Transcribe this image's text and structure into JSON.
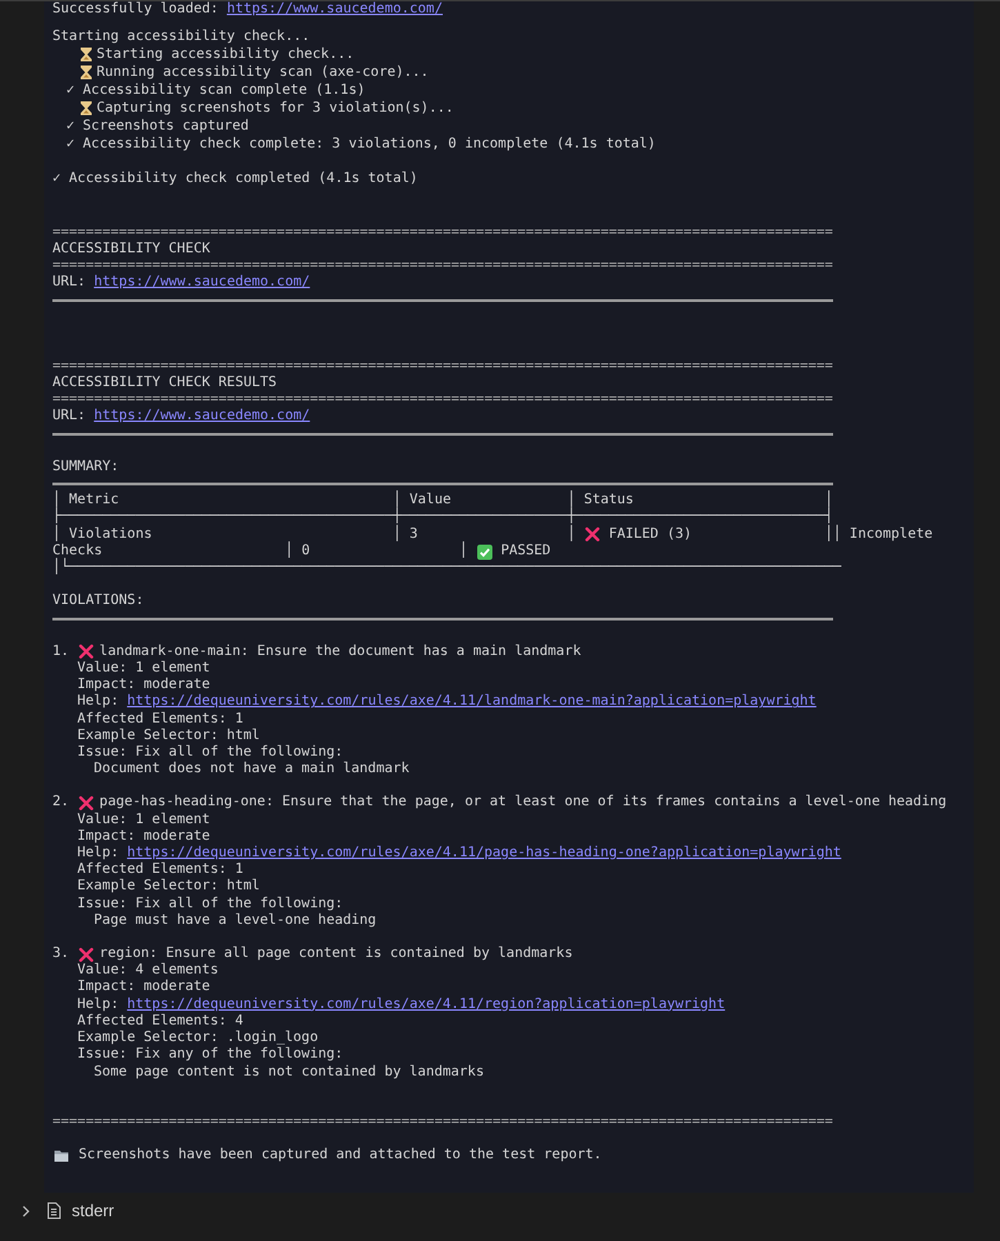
{
  "log": {
    "loaded": {
      "label": "Successfully loaded:",
      "url": "https://www.saucedemo.com/"
    },
    "progress": {
      "title": "Starting accessibility check...",
      "steps": [
        {
          "kind": "pending",
          "text": "Starting accessibility check..."
        },
        {
          "kind": "pending",
          "text": "Running accessibility scan (axe-core)..."
        },
        {
          "kind": "done",
          "mark": "✓",
          "text": "Accessibility scan complete (1.1s)"
        },
        {
          "kind": "pending",
          "text": "Capturing screenshots for 3 violation(s)..."
        },
        {
          "kind": "done",
          "mark": "✓",
          "text": "Screenshots captured"
        },
        {
          "kind": "done",
          "mark": "✓",
          "text": "Accessibility check complete: 3 violations, 0 incomplete (4.1s total)"
        }
      ]
    },
    "completed": {
      "mark": "✓",
      "text": "Accessibility check completed (4.1s total)"
    },
    "banners": [
      {
        "rule": "==============================================================================================",
        "title": "ACCESSIBILITY CHECK",
        "url_label": "URL:",
        "url": "https://www.saucedemo.com/"
      },
      {
        "rule": "==============================================================================================",
        "title": "ACCESSIBILITY CHECK RESULTS",
        "url_label": "URL:",
        "url": "https://www.saucedemo.com/"
      }
    ],
    "summary": {
      "title": "SUMMARY:",
      "lines": [
        [
          {
            "kind": "text",
            "text": "│ Metric                                 │ Value              │ Status                       │"
          }
        ],
        [
          {
            "kind": "text",
            "text": "├────────────────────────────────────────┼────────────────────┼──────────────────────────────┤"
          }
        ],
        [
          {
            "kind": "text",
            "text": "│ Violations                             │ 3                  │ "
          },
          {
            "kind": "fail"
          },
          {
            "kind": "text",
            "text": " FAILED (3)                ││ Incomplete"
          }
        ],
        [
          {
            "kind": "text",
            "text": "Checks                      │ 0                  │ "
          },
          {
            "kind": "pass"
          },
          {
            "kind": "text",
            "text": " PASSED"
          }
        ],
        [
          {
            "kind": "text",
            "text": "│└─────────────────────────────────────────────────────────────────────────────────────────────"
          }
        ]
      ]
    },
    "violations": {
      "title": "VIOLATIONS:",
      "items": [
        {
          "number": "1.",
          "kind": "fail",
          "text": "landmark-one-main: Ensure the document has a main landmark",
          "value": "Value: 1 element",
          "impact": "Impact: moderate",
          "help_label": "Help:",
          "help_url": "https://dequeuniversity.com/rules/axe/4.11/landmark-one-main?application=playwright",
          "affected": "Affected Elements: 1",
          "selector": "Example Selector: html",
          "issue": "Issue: Fix all of the following:",
          "message": "Document does not have a main landmark"
        },
        {
          "number": "2.",
          "kind": "fail",
          "text": "page-has-heading-one: Ensure that the page, or at least one of its frames contains a level-one heading",
          "value": "Value: 1 element",
          "impact": "Impact: moderate",
          "help_label": "Help:",
          "help_url": "https://dequeuniversity.com/rules/axe/4.11/page-has-heading-one?application=playwright",
          "affected": "Affected Elements: 1",
          "selector": "Example Selector: html",
          "issue": "Issue: Fix all of the following:",
          "message": "Page must have a level-one heading"
        },
        {
          "number": "3.",
          "kind": "fail",
          "text": "region: Ensure all page content is contained by landmarks",
          "value": "Value: 4 elements",
          "impact": "Impact: moderate",
          "help_label": "Help:",
          "help_url": "https://dequeuniversity.com/rules/axe/4.11/region?application=playwright",
          "affected": "Affected Elements: 4",
          "selector": "Example Selector: .login_logo",
          "issue": "Issue: Fix any of the following:",
          "message": "Some page content is not contained by landmarks"
        }
      ]
    },
    "footer": {
      "rule": "==============================================================================================",
      "text": "Screenshots have been captured and attached to the test report."
    }
  },
  "stderr": {
    "label": "stderr",
    "expanded": false
  }
}
